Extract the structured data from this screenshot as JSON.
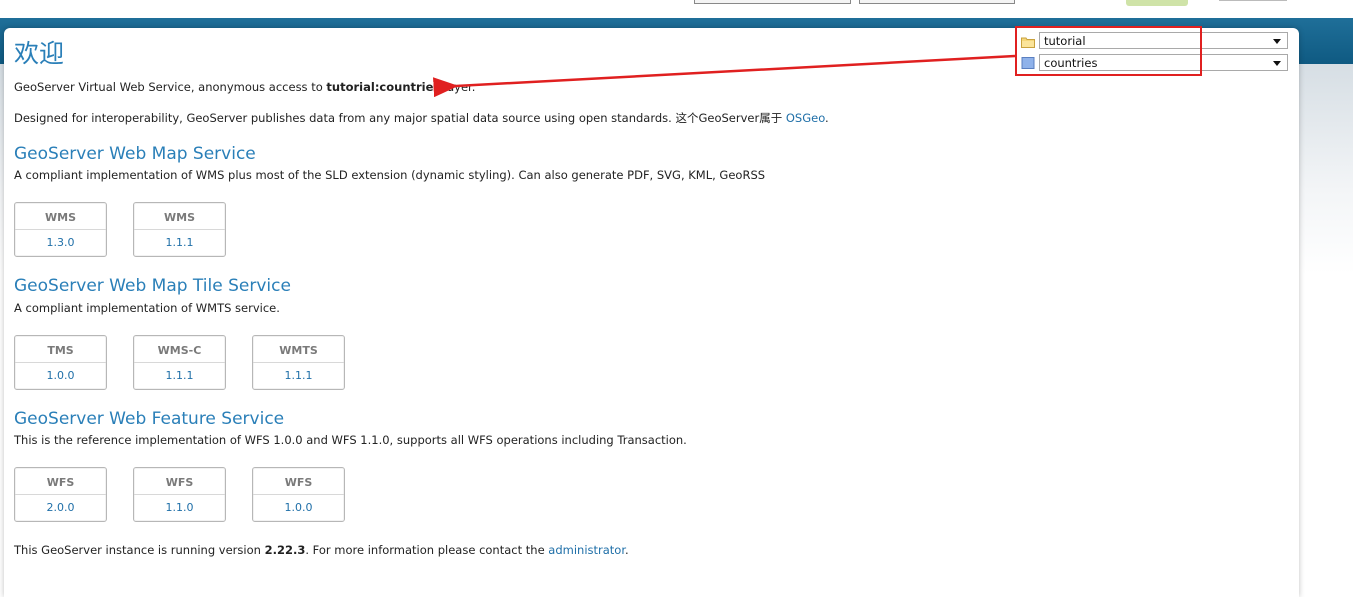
{
  "welcome_title": "欢迎",
  "intro": {
    "prefix": "GeoServer Virtual Web Service, anonymous access to ",
    "layer": "tutorial:countries",
    "suffix": " layer."
  },
  "description": {
    "text": "Designed for interoperability, GeoServer publishes data from any major spatial data source using open standards. 这个GeoServer属于 ",
    "link": "OSGeo",
    "end": "."
  },
  "selectors": {
    "workspace": "tutorial",
    "layer": "countries"
  },
  "services": [
    {
      "title": "GeoServer Web Map Service",
      "desc": "A compliant implementation of WMS plus most of the SLD extension (dynamic styling). Can also generate PDF, SVG, KML, GeoRSS",
      "versions": [
        {
          "name": "WMS",
          "version": "1.3.0"
        },
        {
          "name": "WMS",
          "version": "1.1.1"
        }
      ]
    },
    {
      "title": "GeoServer Web Map Tile Service",
      "desc": "A compliant implementation of WMTS service.",
      "versions": [
        {
          "name": "TMS",
          "version": "1.0.0"
        },
        {
          "name": "WMS-C",
          "version": "1.1.1"
        },
        {
          "name": "WMTS",
          "version": "1.1.1"
        }
      ]
    },
    {
      "title": "GeoServer Web Feature Service",
      "desc": "This is the reference implementation of WFS 1.0.0 and WFS 1.1.0, supports all WFS operations including Transaction.",
      "versions": [
        {
          "name": "WFS",
          "version": "2.0.0"
        },
        {
          "name": "WFS",
          "version": "1.1.0"
        },
        {
          "name": "WFS",
          "version": "1.0.0"
        }
      ]
    }
  ],
  "footer": {
    "prefix": "This GeoServer instance is running version ",
    "version": "2.22.3",
    "middle": ". For more information please contact the ",
    "link": "administrator",
    "end": "."
  },
  "colors": {
    "accent": "#2a7fb8",
    "link": "#1f6fa8",
    "annotation": "#e02020"
  },
  "icons": {
    "workspace": "folder-icon",
    "layer": "layer-icon"
  }
}
